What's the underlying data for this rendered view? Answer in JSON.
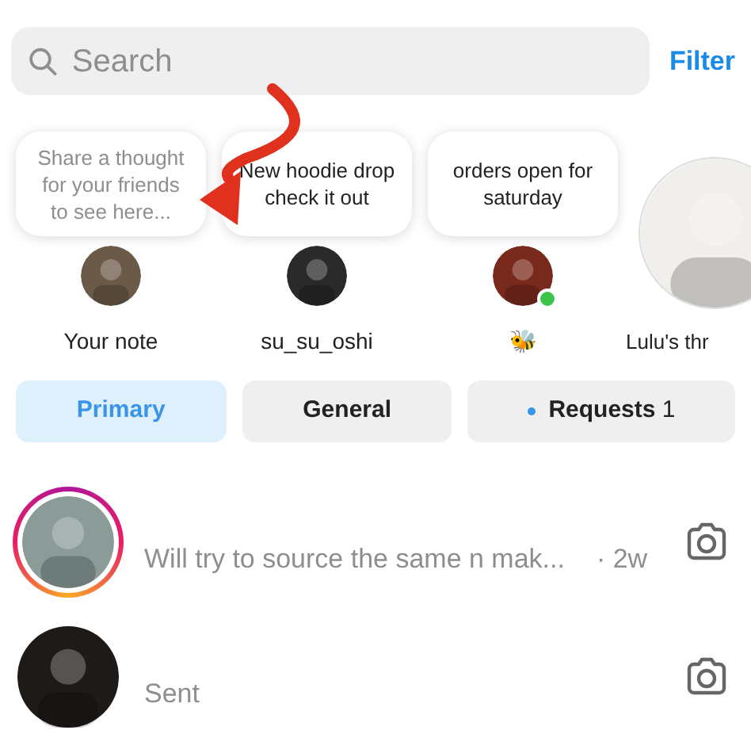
{
  "search": {
    "placeholder": "Search"
  },
  "filter_link": "Filter",
  "notes": [
    {
      "kind": "own",
      "note": "Share a thought for your friends to see here...",
      "name": "Your note",
      "online": false
    },
    {
      "kind": "friend",
      "note": "New hoodie drop check it out",
      "name": "su_su_oshi",
      "online": false
    },
    {
      "kind": "friend",
      "note": "orders open for saturday",
      "name": "🐝",
      "online": true
    },
    {
      "kind": "large",
      "name": "Lulu's thr",
      "online": false
    }
  ],
  "tabs": [
    {
      "label": "Primary",
      "selected": true
    },
    {
      "label": "General",
      "selected": false
    },
    {
      "label": "Requests",
      "count": "1",
      "unread": true,
      "selected": false
    }
  ],
  "chats": [
    {
      "preview": "Will try to source the same n mak...",
      "time": "· 2w",
      "story_ring": true
    },
    {
      "preview": "Sent",
      "story_ring": false
    }
  ]
}
